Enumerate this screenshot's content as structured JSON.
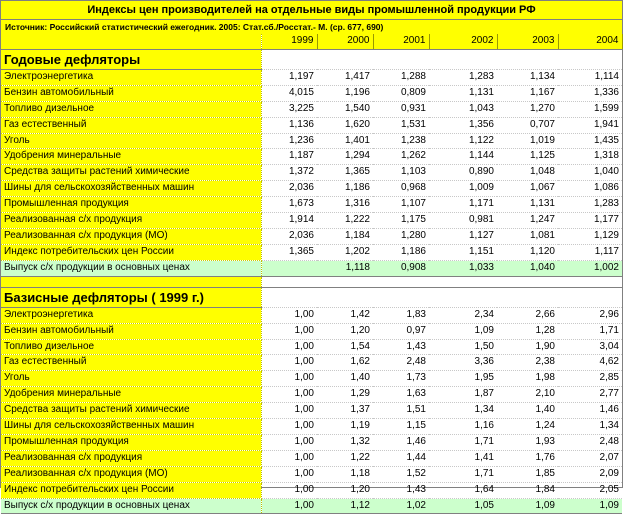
{
  "title": "Индексы цен производителей на отдельные виды промышленной продукции РФ",
  "source": "Источник: Российский статистический ежегодник. 2005: Стат.сб./Росстат.- М. (ср. 677, 690)",
  "years": [
    "1999",
    "2000",
    "2001",
    "2002",
    "2003",
    "2004"
  ],
  "sections": [
    {
      "heading": "Годовые дефляторы",
      "rows": [
        {
          "label": "Электроэнергетика",
          "values": [
            "1,197",
            "1,417",
            "1,288",
            "1,283",
            "1,134",
            "1,114"
          ]
        },
        {
          "label": "Бензин автомобильный",
          "values": [
            "4,015",
            "1,196",
            "0,809",
            "1,131",
            "1,167",
            "1,336"
          ]
        },
        {
          "label": "Топливо дизельное",
          "values": [
            "3,225",
            "1,540",
            "0,931",
            "1,043",
            "1,270",
            "1,599"
          ]
        },
        {
          "label": "Газ естественный",
          "values": [
            "1,136",
            "1,620",
            "1,531",
            "1,356",
            "0,707",
            "1,941"
          ]
        },
        {
          "label": "Уголь",
          "values": [
            "1,236",
            "1,401",
            "1,238",
            "1,122",
            "1,019",
            "1,435"
          ]
        },
        {
          "label": "Удобрения минеральные",
          "values": [
            "1,187",
            "1,294",
            "1,262",
            "1,144",
            "1,125",
            "1,318"
          ]
        },
        {
          "label": "Средства защиты растений химические",
          "values": [
            "1,372",
            "1,365",
            "1,103",
            "0,890",
            "1,048",
            "1,040"
          ]
        },
        {
          "label": "Шины для сельскохозяйственных машин",
          "values": [
            "2,036",
            "1,186",
            "0,968",
            "1,009",
            "1,067",
            "1,086"
          ]
        },
        {
          "label": "Промышленная продукция",
          "values": [
            "1,673",
            "1,316",
            "1,107",
            "1,171",
            "1,131",
            "1,283"
          ]
        },
        {
          "label": "Реализованная с/х продукция",
          "values": [
            "1,914",
            "1,222",
            "1,175",
            "0,981",
            "1,247",
            "1,177"
          ]
        },
        {
          "label": "Реализованная с/х продукция (МО)",
          "values": [
            "2,036",
            "1,184",
            "1,280",
            "1,127",
            "1,081",
            "1,129"
          ]
        },
        {
          "label": "Индекс потребительских цен России",
          "values": [
            "1,365",
            "1,202",
            "1,186",
            "1,151",
            "1,120",
            "1,117"
          ]
        }
      ],
      "total": {
        "label": "Выпуск с/х продукции в основных ценах",
        "values": [
          "",
          "1,118",
          "0,908",
          "1,033",
          "1,040",
          "1,002"
        ]
      }
    },
    {
      "heading": "Базисные дефляторы ( 1999 г.)",
      "rows": [
        {
          "label": "Электроэнергетика",
          "values": [
            "1,00",
            "1,42",
            "1,83",
            "2,34",
            "2,66",
            "2,96"
          ]
        },
        {
          "label": "Бензин автомобильный",
          "values": [
            "1,00",
            "1,20",
            "0,97",
            "1,09",
            "1,28",
            "1,71"
          ]
        },
        {
          "label": "Топливо дизельное",
          "values": [
            "1,00",
            "1,54",
            "1,43",
            "1,50",
            "1,90",
            "3,04"
          ]
        },
        {
          "label": "Газ естественный",
          "values": [
            "1,00",
            "1,62",
            "2,48",
            "3,36",
            "2,38",
            "4,62"
          ]
        },
        {
          "label": "Уголь",
          "values": [
            "1,00",
            "1,40",
            "1,73",
            "1,95",
            "1,98",
            "2,85"
          ]
        },
        {
          "label": "Удобрения минеральные",
          "values": [
            "1,00",
            "1,29",
            "1,63",
            "1,87",
            "2,10",
            "2,77"
          ]
        },
        {
          "label": "Средства защиты растений химические",
          "values": [
            "1,00",
            "1,37",
            "1,51",
            "1,34",
            "1,40",
            "1,46"
          ]
        },
        {
          "label": "Шины для сельскохозяйственных машин",
          "values": [
            "1,00",
            "1,19",
            "1,15",
            "1,16",
            "1,24",
            "1,34"
          ]
        },
        {
          "label": "Промышленная продукция",
          "values": [
            "1,00",
            "1,32",
            "1,46",
            "1,71",
            "1,93",
            "2,48"
          ]
        },
        {
          "label": "Реализованная с/х продукция",
          "values": [
            "1,00",
            "1,22",
            "1,44",
            "1,41",
            "1,76",
            "2,07"
          ]
        },
        {
          "label": "Реализованная с/х продукция (МО)",
          "values": [
            "1,00",
            "1,18",
            "1,52",
            "1,71",
            "1,85",
            "2,09"
          ]
        },
        {
          "label": "Индекс потребительских цен России",
          "values": [
            "1,00",
            "1,20",
            "1,43",
            "1,64",
            "1,84",
            "2,05"
          ]
        }
      ],
      "total": {
        "label": "Выпуск с/х продукции в основных ценах",
        "values": [
          "1,00",
          "1,12",
          "1,02",
          "1,05",
          "1,09",
          "1,09"
        ]
      }
    }
  ]
}
